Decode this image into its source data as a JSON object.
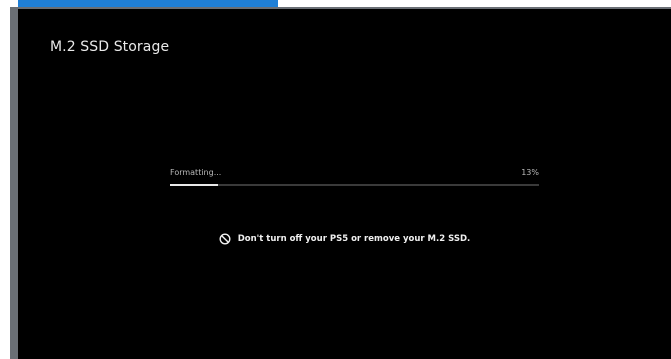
{
  "screen": {
    "title": "M.2 SSD Storage"
  },
  "progress": {
    "label": "Formatting...",
    "percent_text": "13%",
    "value": 13
  },
  "warning": {
    "icon": "prohibited-icon",
    "text": "Don't turn off your PS5 or remove your M.2 SSD."
  },
  "colors": {
    "accent": "#1f7fd6",
    "background": "#000000",
    "frame": "#6a6f75"
  }
}
